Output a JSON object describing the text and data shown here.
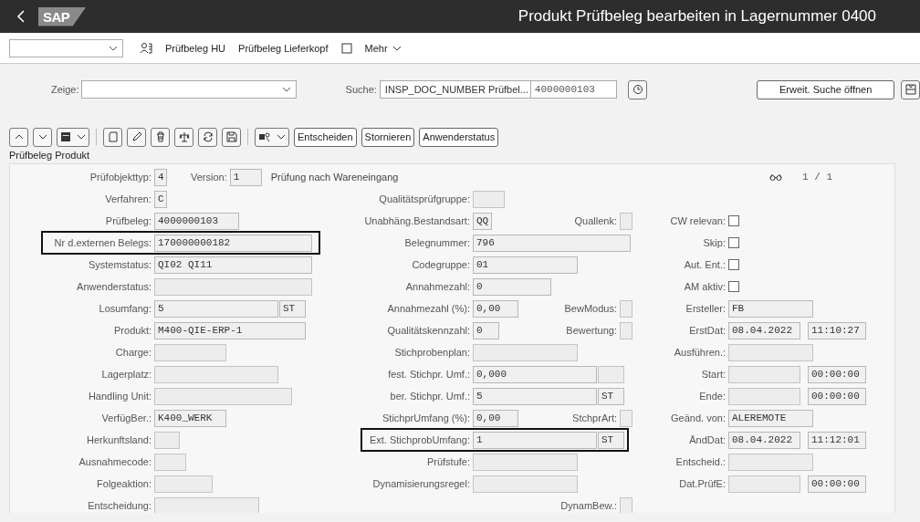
{
  "shell": {
    "logo": "SAP",
    "title": "Produkt Prüfbeleg bearbeiten in Lagernummer 0400"
  },
  "toolbar": {
    "items": [
      "Prüfbeleg HU",
      "Prüfbeleg Lieferkopf"
    ],
    "more": "Mehr"
  },
  "search": {
    "show_label": "Zeige:",
    "search_label": "Suche:",
    "search_type": "INSP_DOC_NUMBER Prüfbel...",
    "search_value": "4000000103",
    "advanced_button": "Erweit. Suche öffnen"
  },
  "actions": [
    "Entscheiden",
    "Stornieren",
    "Anwenderstatus"
  ],
  "section_title": "Prüfbeleg Produkt",
  "form": {
    "rows": [
      {
        "left": {
          "kind": "field",
          "label": "Prüfobjekttyp:",
          "fields": [
            {
              "kind": "text",
              "value": "4"
            }
          ],
          "extra": {
            "label": "Version:",
            "fields": [
              {
                "kind": "text",
                "value": "1"
              }
            ]
          },
          "note": "Prüfung nach Wareneingang",
          "highlighted": false
        },
        "right": {
          "kind": "pager",
          "text": "1 / 1"
        }
      },
      {
        "left": {
          "kind": "field",
          "label": "Verfahren:",
          "fields": [
            {
              "kind": "text",
              "value": "C"
            }
          ],
          "highlighted": false
        },
        "middle": {
          "kind": "field",
          "label": "Qualitätsprüfgruppe:",
          "fields": [
            {
              "kind": "blank"
            }
          ],
          "highlighted": false
        }
      },
      {
        "left": {
          "kind": "field",
          "label": "Prüfbeleg:",
          "fields": [
            {
              "kind": "text",
              "value": "4000000103"
            }
          ],
          "highlighted": false
        },
        "middle": {
          "kind": "field",
          "label": "Unabhäng.Bestandsart:",
          "fields": [
            {
              "kind": "text",
              "value": "QQ"
            }
          ],
          "extra": {
            "label": "Quallenk:",
            "fields": [
              {
                "kind": "blank"
              }
            ]
          },
          "highlighted": false
        },
        "right": {
          "kind": "checkbox",
          "label": "CW relevan:",
          "checked": false
        }
      },
      {
        "left": {
          "kind": "field",
          "label": "Nr d.externen Belegs:",
          "fields": [
            {
              "kind": "text",
              "value": "170000000182"
            }
          ],
          "highlighted": true
        },
        "middle": {
          "kind": "field",
          "label": "Belegnummer:",
          "fields": [
            {
              "kind": "text",
              "value": "796"
            }
          ],
          "highlighted": false
        },
        "right": {
          "kind": "checkbox",
          "label": "Skip:",
          "checked": false
        }
      },
      {
        "left": {
          "kind": "field",
          "label": "Systemstatus:",
          "fields": [
            {
              "kind": "text",
              "value": "QI02 QI11"
            }
          ],
          "highlighted": false
        },
        "middle": {
          "kind": "field",
          "label": "Codegruppe:",
          "fields": [
            {
              "kind": "text",
              "value": "01"
            }
          ],
          "highlighted": false
        },
        "right": {
          "kind": "checkbox",
          "label": "Aut. Ent.:",
          "checked": false
        }
      },
      {
        "left": {
          "kind": "field",
          "label": "Anwenderstatus:",
          "fields": [
            {
              "kind": "blank"
            }
          ],
          "highlighted": false
        },
        "middle": {
          "kind": "field",
          "label": "Annahmezahl:",
          "fields": [
            {
              "kind": "text",
              "value": "0"
            }
          ],
          "highlighted": false
        },
        "right": {
          "kind": "checkbox",
          "label": "AM aktiv:",
          "checked": false
        }
      },
      {
        "left": {
          "kind": "field",
          "label": "Losumfang:",
          "fields": [
            {
              "kind": "text",
              "value": "5"
            },
            {
              "kind": "text",
              "value": "ST"
            }
          ],
          "highlighted": false
        },
        "middle": {
          "kind": "field",
          "label": "Annahmezahl (%):",
          "fields": [
            {
              "kind": "text",
              "value": "0,00"
            }
          ],
          "extra": {
            "label": "BewModus:",
            "fields": [
              {
                "kind": "blank"
              }
            ]
          },
          "highlighted": false
        },
        "right": {
          "kind": "field",
          "label": "Ersteller:",
          "fields": [
            {
              "kind": "text",
              "value": "FB"
            }
          ],
          "highlighted": false
        }
      },
      {
        "left": {
          "kind": "field",
          "label": "Produkt:",
          "fields": [
            {
              "kind": "text",
              "value": "M400-QIE-ERP-1"
            }
          ],
          "highlighted": false
        },
        "middle": {
          "kind": "field",
          "label": "Qualitätskennzahl:",
          "fields": [
            {
              "kind": "text",
              "value": "0"
            }
          ],
          "extra": {
            "label": "Bewertung:",
            "fields": [
              {
                "kind": "blank"
              }
            ]
          },
          "highlighted": false
        },
        "right": {
          "kind": "field",
          "label": "ErstDat:",
          "fields": [
            {
              "kind": "text",
              "value": "08.04.2022"
            },
            {
              "kind": "text",
              "value": "11:10:27"
            }
          ],
          "highlighted": false
        }
      },
      {
        "left": {
          "kind": "field",
          "label": "Charge:",
          "fields": [
            {
              "kind": "blank"
            }
          ],
          "highlighted": false
        },
        "middle": {
          "kind": "field",
          "label": "Stichprobenplan:",
          "fields": [
            {
              "kind": "blank"
            }
          ],
          "highlighted": false
        },
        "right": {
          "kind": "field",
          "label": "Ausführen.:",
          "fields": [
            {
              "kind": "blank"
            }
          ],
          "highlighted": false
        }
      },
      {
        "left": {
          "kind": "field",
          "label": "Lagerplatz:",
          "fields": [
            {
              "kind": "blank"
            }
          ],
          "highlighted": false
        },
        "middle": {
          "kind": "field",
          "label": "fest. Stichpr. Umf.:",
          "fields": [
            {
              "kind": "text",
              "value": "0,000"
            },
            {
              "kind": "blank"
            }
          ],
          "highlighted": false
        },
        "right": {
          "kind": "field",
          "label": "Start:",
          "fields": [
            {
              "kind": "blank"
            },
            {
              "kind": "text",
              "value": "00:00:00"
            }
          ],
          "highlighted": false
        }
      },
      {
        "left": {
          "kind": "field",
          "label": "Handling Unit:",
          "fields": [
            {
              "kind": "blank"
            }
          ],
          "highlighted": false
        },
        "middle": {
          "kind": "field",
          "label": "ber. Stichpr. Umf.:",
          "fields": [
            {
              "kind": "text",
              "value": "5"
            },
            {
              "kind": "text",
              "value": "ST"
            }
          ],
          "highlighted": false
        },
        "right": {
          "kind": "field",
          "label": "Ende:",
          "fields": [
            {
              "kind": "blank"
            },
            {
              "kind": "text",
              "value": "00:00:00"
            }
          ],
          "highlighted": false
        }
      },
      {
        "left": {
          "kind": "field",
          "label": "VerfügBer.:",
          "fields": [
            {
              "kind": "text",
              "value": "K400_WERK"
            }
          ],
          "highlighted": false
        },
        "middle": {
          "kind": "field",
          "label": "StichprUmfang (%):",
          "fields": [
            {
              "kind": "text",
              "value": "0,00"
            }
          ],
          "extra": {
            "label": "StchprArt:",
            "fields": [
              {
                "kind": "blank"
              }
            ]
          },
          "highlighted": false
        },
        "right": {
          "kind": "field",
          "label": "Geänd. von:",
          "fields": [
            {
              "kind": "text",
              "value": "ALEREMOTE"
            }
          ],
          "highlighted": false
        }
      },
      {
        "left": {
          "kind": "field",
          "label": "Herkunftsland:",
          "fields": [
            {
              "kind": "blank"
            }
          ],
          "highlighted": false
        },
        "middle": {
          "kind": "field",
          "label": "Ext. StichprobUmfang:",
          "fields": [
            {
              "kind": "text",
              "value": "1"
            },
            {
              "kind": "text",
              "value": "ST"
            }
          ],
          "highlighted": true
        },
        "right": {
          "kind": "field",
          "label": "ÄndDat:",
          "fields": [
            {
              "kind": "text",
              "value": "08.04.2022"
            },
            {
              "kind": "text",
              "value": "11:12:01"
            }
          ],
          "highlighted": false
        }
      },
      {
        "left": {
          "kind": "field",
          "label": "Ausnahmecode:",
          "fields": [
            {
              "kind": "blank"
            }
          ],
          "highlighted": false
        },
        "middle": {
          "kind": "field",
          "label": "Prüfstufe:",
          "fields": [
            {
              "kind": "blank"
            }
          ],
          "highlighted": false
        },
        "right": {
          "kind": "field",
          "label": "Entscheid.:",
          "fields": [
            {
              "kind": "blank"
            }
          ],
          "highlighted": false
        }
      },
      {
        "left": {
          "kind": "field",
          "label": "Folgeaktion:",
          "fields": [
            {
              "kind": "blank"
            }
          ],
          "highlighted": false
        },
        "middle": {
          "kind": "field",
          "label": "Dynamisierungsregel:",
          "fields": [
            {
              "kind": "blank"
            }
          ],
          "highlighted": false
        },
        "right": {
          "kind": "field",
          "label": "Dat.PrüfE:",
          "fields": [
            {
              "kind": "blank"
            },
            {
              "kind": "text",
              "value": "00:00:00"
            }
          ],
          "highlighted": false
        }
      },
      {
        "left": {
          "kind": "field",
          "label": "Entscheidung:",
          "fields": [
            {
              "kind": "blank"
            }
          ],
          "highlighted": false
        },
        "middle": {
          "kind": "field",
          "extra": {
            "label": "DynamBew.:",
            "fields": [
              {
                "kind": "blank"
              }
            ]
          },
          "highlighted": false
        }
      }
    ]
  }
}
